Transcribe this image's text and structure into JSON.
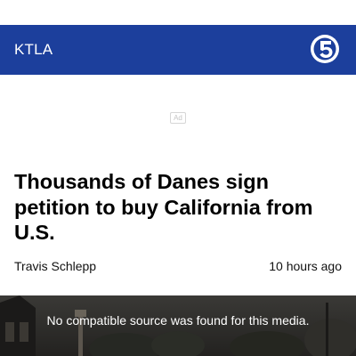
{
  "header": {
    "brand": "KTLA",
    "logo_icon": "channel-5-logo-icon",
    "background": "#1c3f9c"
  },
  "ad": {
    "label": "Ad"
  },
  "article": {
    "headline": "Thousands of Danes sign petition to buy California from U.S.",
    "author": "Travis Schlepp",
    "timestamp": "10 hours ago"
  },
  "media": {
    "message": "No compatible source was found for this media."
  }
}
